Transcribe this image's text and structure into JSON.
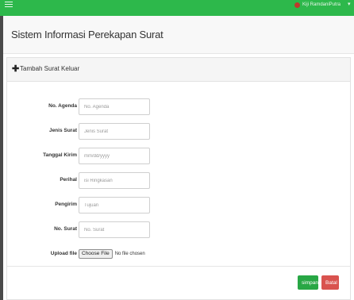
{
  "topbar": {
    "menu_icon": "hamburger-menu-icon",
    "username": "Kiji RamdaniPutra",
    "caret": "▾",
    "accent": "#2db84b"
  },
  "header": {
    "title": "Sistem Informasi Perekapan Surat"
  },
  "panel": {
    "icon": "plus-icon",
    "icon_glyph": "✚",
    "heading": "Tambah Surat Keluar"
  },
  "form": {
    "no_agenda": {
      "label": "No. Agenda",
      "placeholder": "No. Agenda"
    },
    "jenis_surat": {
      "label": "Jenis Surat",
      "placeholder": "Jenis Surat"
    },
    "tanggal_kirim": {
      "label": "Tanggal Kirim",
      "placeholder": "mm/dd/yyyy"
    },
    "perihal": {
      "label": "Perihal",
      "placeholder": "isi Ringkasan"
    },
    "pengirim": {
      "label": "Pengirim",
      "placeholder": "Tujuan"
    },
    "no_surat": {
      "label": "No. Surat",
      "placeholder": "No. Surat"
    },
    "upload": {
      "label": "Upload file",
      "button": "Choose File",
      "status": "No file chosen"
    }
  },
  "actions": {
    "save": "simpan",
    "cancel": "Batal",
    "save_color": "#28a745",
    "cancel_color": "#d9534f"
  }
}
